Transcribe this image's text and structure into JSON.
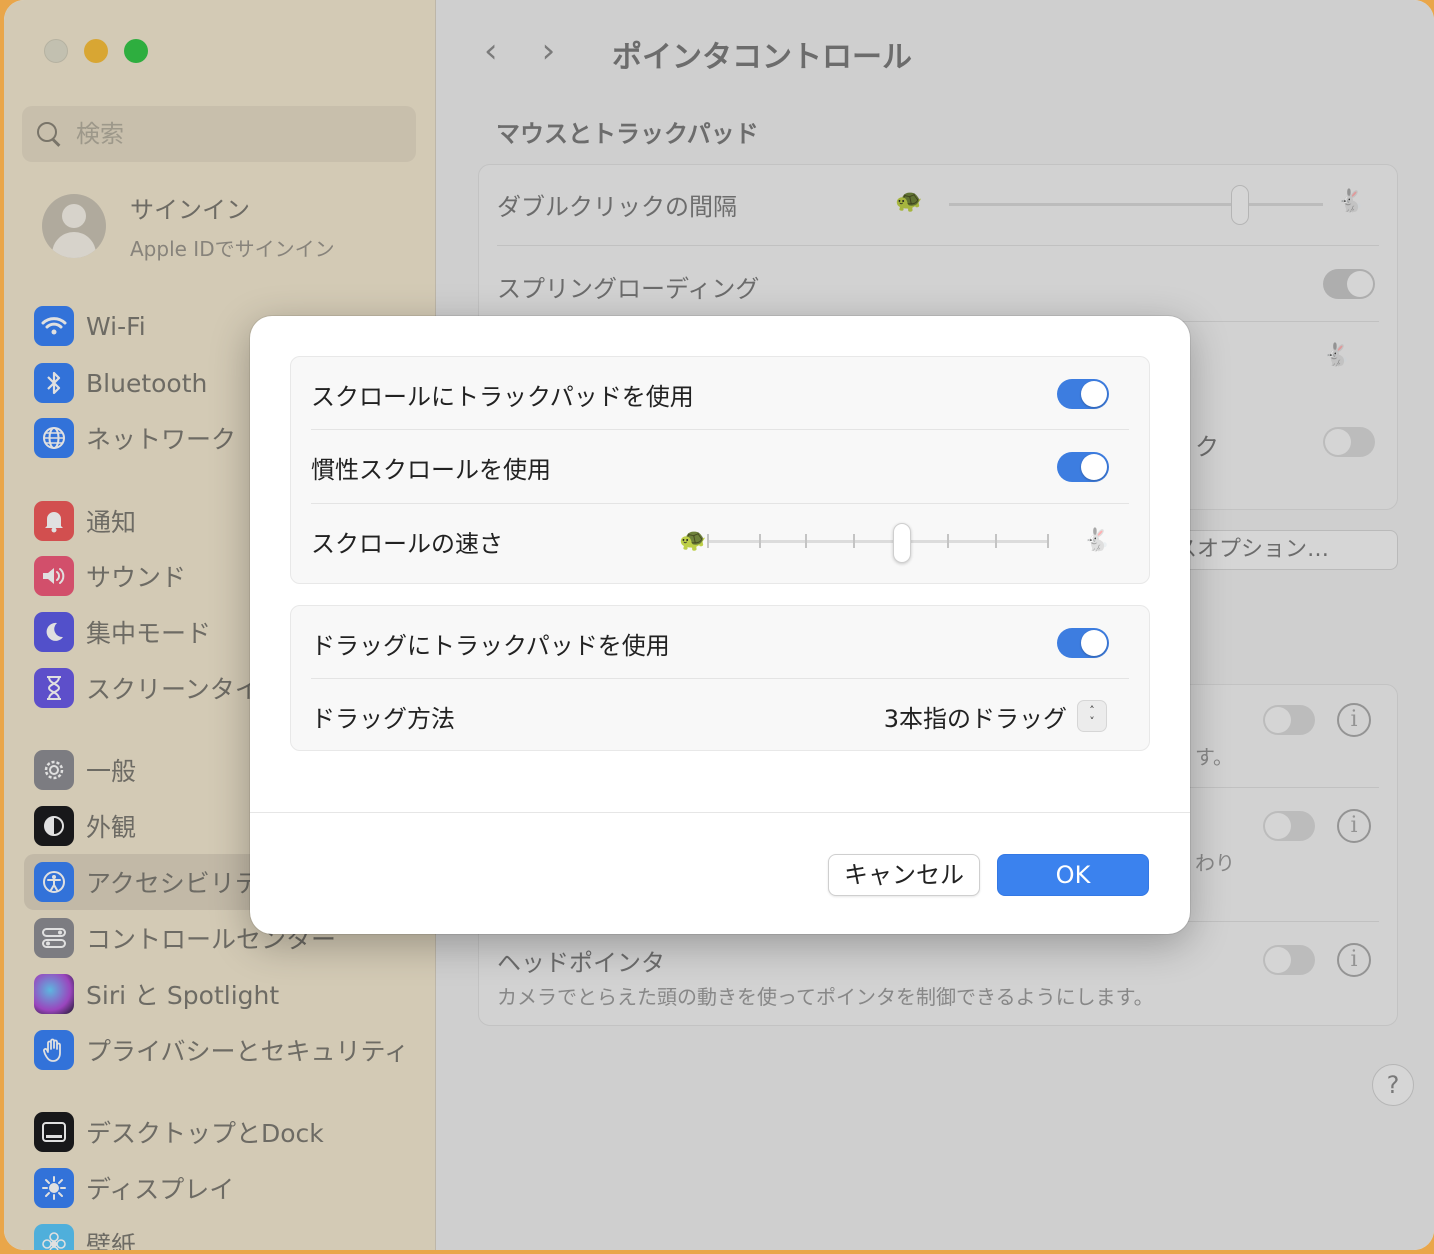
{
  "sidebar": {
    "search_placeholder": "検索",
    "account": {
      "name": "サインイン",
      "sub": "Apple IDでサインイン"
    },
    "items": [
      {
        "label": "Wi-Fi",
        "icon": "wifi-icon",
        "color": "#3a82f7"
      },
      {
        "label": "Bluetooth",
        "icon": "bluetooth-icon",
        "color": "#3a82f7"
      },
      {
        "label": "ネットワーク",
        "icon": "globe-icon",
        "color": "#3a82f7"
      },
      {
        "label": "通知",
        "icon": "bell-icon",
        "color": "#f05a5a"
      },
      {
        "label": "サウンド",
        "icon": "speaker-icon",
        "color": "#f05a7a"
      },
      {
        "label": "集中モード",
        "icon": "moon-icon",
        "color": "#5e5ce6"
      },
      {
        "label": "スクリーンタイム",
        "icon": "hourglass-icon",
        "color": "#6a5ae6"
      },
      {
        "label": "一般",
        "icon": "gear-icon",
        "color": "#8e8e93"
      },
      {
        "label": "外観",
        "icon": "appearance-icon",
        "color": "#1c1c1e"
      },
      {
        "label": "アクセシビリティ",
        "icon": "accessibility-icon",
        "color": "#3a82f7"
      },
      {
        "label": "コントロールセンター",
        "icon": "control-center-icon",
        "color": "#8e8e93"
      },
      {
        "label": "Siri と Spotlight",
        "icon": "siri-icon",
        "color": "#b04fd8"
      },
      {
        "label": "プライバシーとセキュリティ",
        "icon": "hand-icon",
        "color": "#3a82f7"
      },
      {
        "label": "デスクトップとDock",
        "icon": "dock-icon",
        "color": "#1c1c1e"
      },
      {
        "label": "ディスプレイ",
        "icon": "sun-icon",
        "color": "#3a82f7"
      },
      {
        "label": "壁紙",
        "icon": "wallpaper-icon",
        "color": "#5ac8fa"
      }
    ]
  },
  "main": {
    "title": "ポインタコントロール",
    "section": "マウスとトラックパッド",
    "rows": {
      "double_click": "ダブルクリックの間隔",
      "spring_loading": "スプリングローディング",
      "partial_right": "ク",
      "options_button": "ウスオプション…",
      "partial_sub1": "す。",
      "partial_sub2": "わり",
      "head_pointer": "ヘッドポインタ",
      "head_pointer_desc": "カメラでとらえた頭の動きを使ってポインタを制御できるようにします。"
    },
    "help": "?"
  },
  "sheet": {
    "scroll_trackpad": {
      "label": "スクロールにトラックパッドを使用",
      "on": true
    },
    "inertia": {
      "label": "慣性スクロールを使用",
      "on": true
    },
    "scroll_speed": {
      "label": "スクロールの速さ",
      "value": 0.57
    },
    "drag_trackpad": {
      "label": "ドラッグにトラックパッドを使用",
      "on": true
    },
    "drag_method": {
      "label": "ドラッグ方法",
      "value": "3本指のドラッグ"
    },
    "cancel": "キャンセル",
    "ok": "OK"
  }
}
